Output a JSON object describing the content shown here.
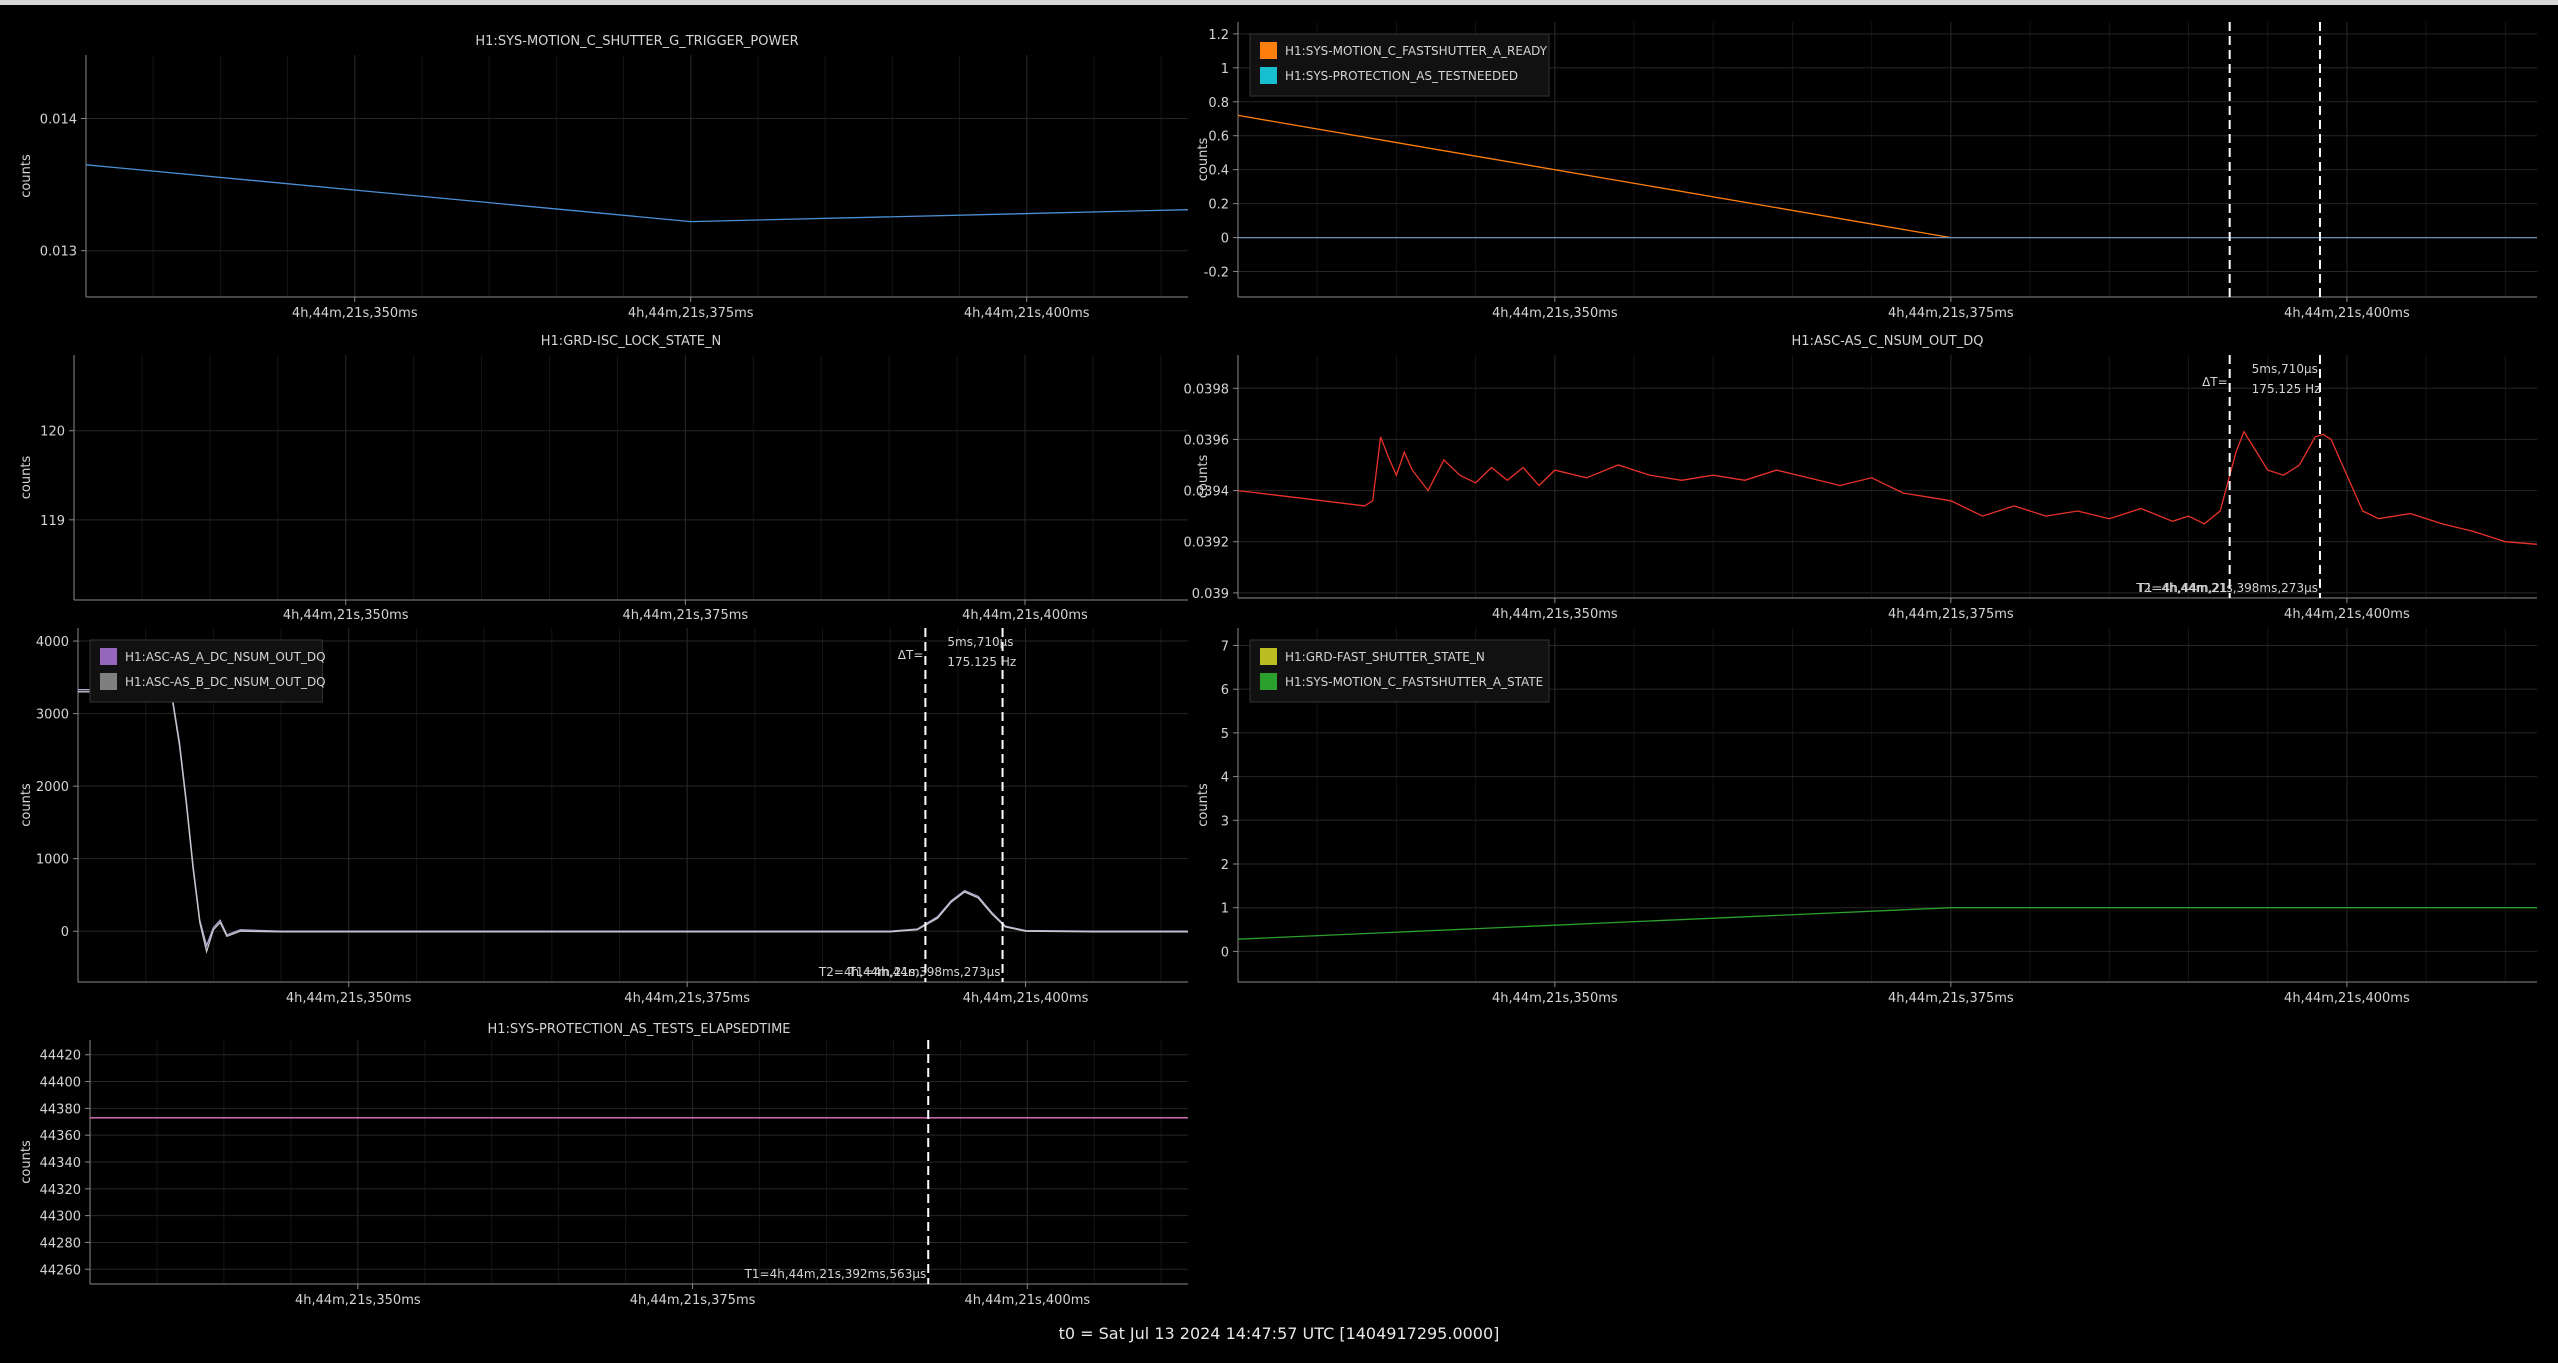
{
  "footer": "t0 = Sat Jul 13 2024 14:47:57 UTC [1404917295.0000]",
  "colors": {
    "background": "#000000",
    "grid": "#262626",
    "axis": "#8a8a8a",
    "text": "#d4d4d4",
    "cursor": "#ffffff"
  },
  "chart_data": [
    {
      "type": "line",
      "title": "H1:SYS-MOTION_C_SHUTTER_G_TRIGGER_POWER",
      "ylabel": "counts",
      "xlim": [
        21.33,
        21.412
      ],
      "ylim": [
        0.01265,
        0.01448
      ],
      "yticks": [
        0.013,
        0.014
      ],
      "ytick_labels": [
        "0.013",
        "0.014"
      ],
      "xticks": [
        21.35,
        21.375,
        21.4
      ],
      "xtick_labels": [
        "4h,44m,21s,350ms",
        "4h,44m,21s,375ms",
        "4h,44m,21s,400ms"
      ],
      "grid": true,
      "legend": null,
      "series": [
        {
          "color": "#4c8fd6",
          "x": [
            21.33,
            21.375,
            21.412
          ],
          "y": [
            0.01365,
            0.01322,
            0.01331
          ]
        }
      ],
      "cursors": []
    },
    {
      "type": "line",
      "title": "",
      "ylabel": "counts",
      "xlim": [
        21.33,
        21.412
      ],
      "ylim": [
        -0.35,
        1.27
      ],
      "yticks": [
        -0.2,
        0,
        0.2,
        0.4,
        0.6,
        0.8,
        1,
        1.2
      ],
      "ytick_labels": [
        "-0.2",
        "0",
        "0.2",
        "0.4",
        "0.6",
        "0.8",
        "1",
        "1.2"
      ],
      "xticks": [
        21.35,
        21.375,
        21.4
      ],
      "xtick_labels": [
        "4h,44m,21s,350ms",
        "4h,44m,21s,375ms",
        "4h,44m,21s,400ms"
      ],
      "grid": true,
      "legend": "top-left",
      "series": [
        {
          "name": "H1:SYS-MOTION_C_FASTSHUTTER_A_READY",
          "color": "#ff7f0e",
          "x": [
            21.33,
            21.375
          ],
          "y": [
            0.72,
            0
          ]
        },
        {
          "name": "H1:SYS-PROTECTION_AS_TESTNEEDED",
          "color": "#17becf",
          "x": [
            21.33,
            21.412
          ],
          "y": [
            0,
            0
          ]
        }
      ],
      "series_draw_color": [
        "#ff7f0e",
        "#6f8fb5"
      ],
      "cursors": [
        21.3926,
        21.3983
      ]
    },
    {
      "type": "line",
      "title": "H1:GRD-ISC_LOCK_STATE_N",
      "ylabel": "counts",
      "xlim": [
        21.33,
        21.412
      ],
      "ylim": [
        118.1,
        120.85
      ],
      "yticks": [
        119,
        120
      ],
      "ytick_labels": [
        "119",
        "120"
      ],
      "xticks": [
        21.35,
        21.375,
        21.4
      ],
      "xtick_labels": [
        "4h,44m,21s,350ms",
        "4h,44m,21s,375ms",
        "4h,44m,21s,400ms"
      ],
      "grid": true,
      "legend": null,
      "series": [],
      "cursors": []
    },
    {
      "type": "line",
      "title": "H1:ASC-AS_C_NSUM_OUT_DQ",
      "ylabel": "counts",
      "xlim": [
        21.33,
        21.412
      ],
      "ylim": [
        0.03898,
        0.03993
      ],
      "yticks": [
        0.039,
        0.0392,
        0.0394,
        0.0396,
        0.0398
      ],
      "ytick_labels": [
        "0.039",
        "0.0392",
        "0.0394",
        "0.0396",
        "0.0398"
      ],
      "xticks": [
        21.35,
        21.375,
        21.4
      ],
      "xtick_labels": [
        "4h,44m,21s,350ms",
        "4h,44m,21s,375ms",
        "4h,44m,21s,400ms"
      ],
      "grid": true,
      "legend": null,
      "series": [
        {
          "color": "#e8322a",
          "x": [
            21.33,
            21.334,
            21.338,
            21.3385,
            21.339,
            21.3395,
            21.34,
            21.3405,
            21.341,
            21.342,
            21.343,
            21.344,
            21.345,
            21.346,
            21.347,
            21.348,
            21.349,
            21.35,
            21.352,
            21.354,
            21.356,
            21.358,
            21.36,
            21.362,
            21.364,
            21.366,
            21.368,
            21.37,
            21.372,
            21.374,
            21.375,
            21.377,
            21.379,
            21.381,
            21.383,
            21.385,
            21.387,
            21.389,
            21.39,
            21.391,
            21.392,
            21.393,
            21.3935,
            21.394,
            21.395,
            21.396,
            21.397,
            21.398,
            21.3985,
            21.399,
            21.4,
            21.401,
            21.402,
            21.404,
            21.406,
            21.408,
            21.41,
            21.412
          ],
          "y": [
            0.0394,
            0.03937,
            0.03934,
            0.03936,
            0.03961,
            0.03953,
            0.03946,
            0.03955,
            0.03948,
            0.0394,
            0.03952,
            0.03946,
            0.03943,
            0.03949,
            0.03944,
            0.03949,
            0.03942,
            0.03948,
            0.03945,
            0.0395,
            0.03946,
            0.03944,
            0.03946,
            0.03944,
            0.03948,
            0.03945,
            0.03942,
            0.03945,
            0.03939,
            0.03937,
            0.03936,
            0.0393,
            0.03934,
            0.0393,
            0.03932,
            0.03929,
            0.03933,
            0.03928,
            0.0393,
            0.03927,
            0.03932,
            0.03955,
            0.03963,
            0.03958,
            0.03948,
            0.03946,
            0.0395,
            0.03961,
            0.03962,
            0.0396,
            0.03946,
            0.03932,
            0.03929,
            0.03931,
            0.03927,
            0.03924,
            0.0392,
            0.03919
          ]
        }
      ],
      "cursors": [
        21.3926,
        21.3983
      ],
      "cursor_labels": [
        "ΔT=",
        "5ms,710µs",
        "175.125 Hz",
        "T1=4h,44m,21",
        "T2=4h,44m,21s,398ms,273µs"
      ]
    },
    {
      "type": "line",
      "title": "",
      "ylabel": "counts",
      "xlim": [
        21.33,
        21.412
      ],
      "ylim": [
        -700,
        4180
      ],
      "yticks": [
        0,
        1000,
        2000,
        3000,
        4000
      ],
      "ytick_labels": [
        "0",
        "1000",
        "2000",
        "3000",
        "4000"
      ],
      "xticks": [
        21.35,
        21.375,
        21.4
      ],
      "xtick_labels": [
        "4h,44m,21s,350ms",
        "4h,44m,21s,375ms",
        "4h,44m,21s,400ms"
      ],
      "grid": true,
      "legend": "top-left",
      "series": [
        {
          "name": "H1:ASC-AS_A_DC_NSUM_OUT_DQ",
          "color": "#9467bd",
          "x": [
            21.33,
            21.3365,
            21.337,
            21.3375,
            21.338,
            21.3385,
            21.339,
            21.3395,
            21.34,
            21.3405,
            21.341,
            21.342,
            21.345,
            21.35,
            21.36,
            21.37,
            21.38,
            21.39,
            21.392,
            21.3935,
            21.3945,
            21.3955,
            21.3965,
            21.3975,
            21.3985,
            21.4,
            21.405,
            21.412
          ],
          "y": [
            3330,
            3330,
            3180,
            2600,
            1800,
            900,
            150,
            -200,
            50,
            150,
            -50,
            20,
            0,
            0,
            0,
            0,
            0,
            0,
            30,
            200,
            420,
            560,
            480,
            260,
            70,
            10,
            0,
            0
          ]
        },
        {
          "name": "H1:ASC-AS_B_DC_NSUM_OUT_DQ",
          "color": "#7f7f7f",
          "x": [
            21.33,
            21.3365,
            21.337,
            21.3375,
            21.338,
            21.3385,
            21.339,
            21.3395,
            21.34,
            21.3405,
            21.341,
            21.342,
            21.345,
            21.35,
            21.36,
            21.37,
            21.38,
            21.39,
            21.392,
            21.3935,
            21.3945,
            21.3955,
            21.3965,
            21.3975,
            21.3985,
            21.4,
            21.405,
            21.412
          ],
          "y": [
            3300,
            3300,
            3150,
            2560,
            1760,
            860,
            120,
            -280,
            20,
            120,
            -70,
            0,
            -10,
            -10,
            -10,
            -10,
            -10,
            -10,
            20,
            180,
            400,
            540,
            460,
            240,
            60,
            0,
            -10,
            -10
          ]
        }
      ],
      "series_draw_color": [
        "#b0a8d8",
        "#c8c8c8"
      ],
      "cursors": [
        21.3926,
        21.3983
      ],
      "cursor_labels": [
        "ΔT=",
        "5ms,710µs",
        "175.125 Hz",
        "T1=4h,44m,",
        "T2=4h,44m,21s,398ms,273µs"
      ]
    },
    {
      "type": "line",
      "title": "",
      "ylabel": "counts",
      "xlim": [
        21.33,
        21.412
      ],
      "ylim": [
        -0.7,
        7.4
      ],
      "yticks": [
        0,
        1,
        2,
        3,
        4,
        5,
        6,
        7
      ],
      "ytick_labels": [
        "0",
        "1",
        "2",
        "3",
        "4",
        "5",
        "6",
        "7"
      ],
      "xticks": [
        21.35,
        21.375,
        21.4
      ],
      "xtick_labels": [
        "4h,44m,21s,350ms",
        "4h,44m,21s,375ms",
        "4h,44m,21s,400ms"
      ],
      "grid": true,
      "legend": "top-left",
      "series": [
        {
          "name": "H1:GRD-FAST_SHUTTER_STATE_N",
          "color": "#bcbd22",
          "x": [],
          "y": []
        },
        {
          "name": "H1:SYS-MOTION_C_FASTSHUTTER_A_STATE",
          "color": "#2ca02c",
          "x": [
            21.33,
            21.375,
            21.412
          ],
          "y": [
            0.28,
            1,
            1
          ]
        }
      ],
      "cursors": []
    },
    {
      "type": "line",
      "title": "H1:SYS-PROTECTION_AS_TESTS_ELAPSEDTIME",
      "ylabel": "counts",
      "xlim": [
        21.33,
        21.412
      ],
      "ylim": [
        44249,
        44431
      ],
      "yticks": [
        44260,
        44280,
        44300,
        44320,
        44340,
        44360,
        44380,
        44400,
        44420
      ],
      "ytick_labels": [
        "44260",
        "44280",
        "44300",
        "44320",
        "44340",
        "44360",
        "44380",
        "44400",
        "44420"
      ],
      "xticks": [
        21.35,
        21.375,
        21.4
      ],
      "xtick_labels": [
        "4h,44m,21s,350ms",
        "4h,44m,21s,375ms",
        "4h,44m,21s,400ms"
      ],
      "grid": true,
      "legend": null,
      "series": [
        {
          "color": "#e377c2",
          "x": [
            21.33,
            21.412
          ],
          "y": [
            44373,
            44373
          ]
        }
      ],
      "cursors": [
        21.3926
      ],
      "cursor_labels": [
        "T1=4h,44m,21s,392ms,563µs"
      ]
    }
  ]
}
